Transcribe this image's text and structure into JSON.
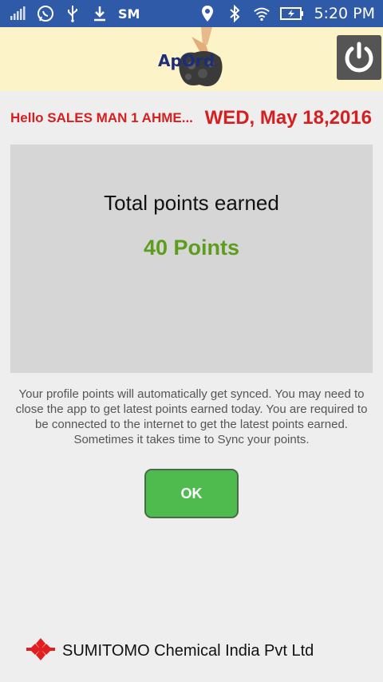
{
  "status_bar": {
    "carrier_label": "SM",
    "time": "5:20 PM",
    "icons": [
      "signal-icon",
      "whatsapp-icon",
      "usb-icon",
      "download-icon",
      "location-icon",
      "bluetooth-icon",
      "wifi-icon",
      "battery-charging-icon"
    ]
  },
  "app_bar": {
    "logo_text": "ApOrd",
    "power_icon": "power-icon"
  },
  "header": {
    "greeting": "Hello SALES MAN 1 AHME...",
    "date": "WED, May 18,2016"
  },
  "points": {
    "title": "Total points earned",
    "value": "40 Points"
  },
  "info_text": "Your profile points will automatically get synced. You may need to close the app to get latest points earned today. You are required to be connected to the internet to get the latest points earned. Sometimes it takes time to Sync your points.",
  "actions": {
    "ok_label": "OK"
  },
  "footer": {
    "company": "SUMITOMO Chemical India Pvt Ltd"
  },
  "colors": {
    "status_bar": "#2f5aa8",
    "app_bar": "#fcf3c8",
    "greeting": "#d42020",
    "points_value": "#5d9d1e",
    "ok_button": "#4fbb4f"
  }
}
